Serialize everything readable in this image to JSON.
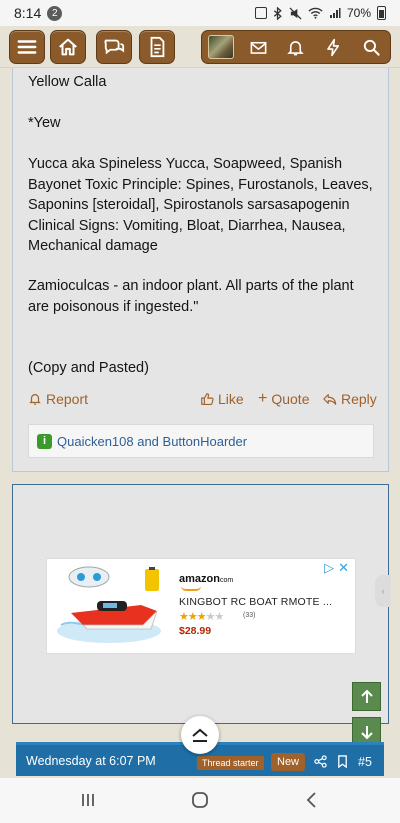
{
  "status_bar": {
    "time": "8:14",
    "notification_count": "2",
    "battery": "70%"
  },
  "navbar": {
    "buttons": [
      "menu-icon",
      "home-icon",
      "chat-icon",
      "document-icon"
    ],
    "group_icons": [
      "avatar",
      "mail-icon",
      "bell-icon",
      "bolt-icon",
      "search-icon"
    ],
    "accent": "#8a5a2a"
  },
  "post": {
    "paragraphs": [
      "Yellow Calla",
      "*Yew",
      "Yucca aka Spineless Yucca, Soapweed, Spanish Bayonet Toxic Principle: Spines, Furostanols, Leaves, Saponins [steroidal], Spirostanols sarsasapogenin Clinical Signs: Vomiting, Bloat, Diarrhea, Nausea, Mechanical damage",
      "Zamioculcas - an indoor plant. All parts of the plant are poisonous if ingested.\"",
      "(Copy and Pasted)"
    ],
    "actions": {
      "report": "Report",
      "like": "Like",
      "quote": "Quote",
      "reply": "Reply"
    },
    "reactions_text": "Quaicken108 and ButtonHoarder"
  },
  "ad": {
    "brand": "amazon",
    "brand_suffix": "com",
    "title": "KINGBOT RC BOAT RMOTE ...",
    "rating_stars": 3,
    "rating_max": 5,
    "rating_count": "(33)",
    "price": "$28.99"
  },
  "next_post": {
    "timestamp": "Wednesday at 6:07 PM",
    "thread_starter": "Thread starter",
    "new_label": "New",
    "post_number": "#5"
  },
  "colors": {
    "link": "#a0612a",
    "header_blue": "#1f6fa6",
    "scroll_green": "#5a8a4e"
  }
}
